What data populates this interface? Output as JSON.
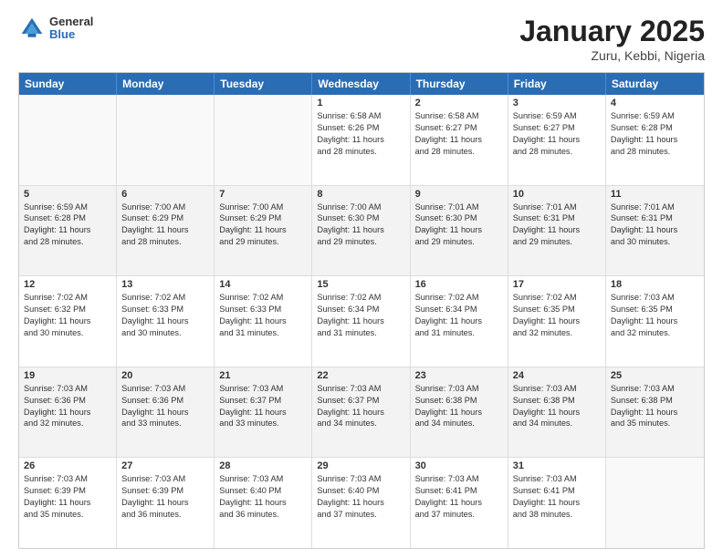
{
  "header": {
    "logo": {
      "general": "General",
      "blue": "Blue"
    },
    "title": "January 2025",
    "location": "Zuru, Kebbi, Nigeria"
  },
  "days_of_week": [
    "Sunday",
    "Monday",
    "Tuesday",
    "Wednesday",
    "Thursday",
    "Friday",
    "Saturday"
  ],
  "weeks": [
    [
      {
        "day": "",
        "info": ""
      },
      {
        "day": "",
        "info": ""
      },
      {
        "day": "",
        "info": ""
      },
      {
        "day": "1",
        "info": "Sunrise: 6:58 AM\nSunset: 6:26 PM\nDaylight: 11 hours\nand 28 minutes."
      },
      {
        "day": "2",
        "info": "Sunrise: 6:58 AM\nSunset: 6:27 PM\nDaylight: 11 hours\nand 28 minutes."
      },
      {
        "day": "3",
        "info": "Sunrise: 6:59 AM\nSunset: 6:27 PM\nDaylight: 11 hours\nand 28 minutes."
      },
      {
        "day": "4",
        "info": "Sunrise: 6:59 AM\nSunset: 6:28 PM\nDaylight: 11 hours\nand 28 minutes."
      }
    ],
    [
      {
        "day": "5",
        "info": "Sunrise: 6:59 AM\nSunset: 6:28 PM\nDaylight: 11 hours\nand 28 minutes."
      },
      {
        "day": "6",
        "info": "Sunrise: 7:00 AM\nSunset: 6:29 PM\nDaylight: 11 hours\nand 28 minutes."
      },
      {
        "day": "7",
        "info": "Sunrise: 7:00 AM\nSunset: 6:29 PM\nDaylight: 11 hours\nand 29 minutes."
      },
      {
        "day": "8",
        "info": "Sunrise: 7:00 AM\nSunset: 6:30 PM\nDaylight: 11 hours\nand 29 minutes."
      },
      {
        "day": "9",
        "info": "Sunrise: 7:01 AM\nSunset: 6:30 PM\nDaylight: 11 hours\nand 29 minutes."
      },
      {
        "day": "10",
        "info": "Sunrise: 7:01 AM\nSunset: 6:31 PM\nDaylight: 11 hours\nand 29 minutes."
      },
      {
        "day": "11",
        "info": "Sunrise: 7:01 AM\nSunset: 6:31 PM\nDaylight: 11 hours\nand 30 minutes."
      }
    ],
    [
      {
        "day": "12",
        "info": "Sunrise: 7:02 AM\nSunset: 6:32 PM\nDaylight: 11 hours\nand 30 minutes."
      },
      {
        "day": "13",
        "info": "Sunrise: 7:02 AM\nSunset: 6:33 PM\nDaylight: 11 hours\nand 30 minutes."
      },
      {
        "day": "14",
        "info": "Sunrise: 7:02 AM\nSunset: 6:33 PM\nDaylight: 11 hours\nand 31 minutes."
      },
      {
        "day": "15",
        "info": "Sunrise: 7:02 AM\nSunset: 6:34 PM\nDaylight: 11 hours\nand 31 minutes."
      },
      {
        "day": "16",
        "info": "Sunrise: 7:02 AM\nSunset: 6:34 PM\nDaylight: 11 hours\nand 31 minutes."
      },
      {
        "day": "17",
        "info": "Sunrise: 7:02 AM\nSunset: 6:35 PM\nDaylight: 11 hours\nand 32 minutes."
      },
      {
        "day": "18",
        "info": "Sunrise: 7:03 AM\nSunset: 6:35 PM\nDaylight: 11 hours\nand 32 minutes."
      }
    ],
    [
      {
        "day": "19",
        "info": "Sunrise: 7:03 AM\nSunset: 6:36 PM\nDaylight: 11 hours\nand 32 minutes."
      },
      {
        "day": "20",
        "info": "Sunrise: 7:03 AM\nSunset: 6:36 PM\nDaylight: 11 hours\nand 33 minutes."
      },
      {
        "day": "21",
        "info": "Sunrise: 7:03 AM\nSunset: 6:37 PM\nDaylight: 11 hours\nand 33 minutes."
      },
      {
        "day": "22",
        "info": "Sunrise: 7:03 AM\nSunset: 6:37 PM\nDaylight: 11 hours\nand 34 minutes."
      },
      {
        "day": "23",
        "info": "Sunrise: 7:03 AM\nSunset: 6:38 PM\nDaylight: 11 hours\nand 34 minutes."
      },
      {
        "day": "24",
        "info": "Sunrise: 7:03 AM\nSunset: 6:38 PM\nDaylight: 11 hours\nand 34 minutes."
      },
      {
        "day": "25",
        "info": "Sunrise: 7:03 AM\nSunset: 6:38 PM\nDaylight: 11 hours\nand 35 minutes."
      }
    ],
    [
      {
        "day": "26",
        "info": "Sunrise: 7:03 AM\nSunset: 6:39 PM\nDaylight: 11 hours\nand 35 minutes."
      },
      {
        "day": "27",
        "info": "Sunrise: 7:03 AM\nSunset: 6:39 PM\nDaylight: 11 hours\nand 36 minutes."
      },
      {
        "day": "28",
        "info": "Sunrise: 7:03 AM\nSunset: 6:40 PM\nDaylight: 11 hours\nand 36 minutes."
      },
      {
        "day": "29",
        "info": "Sunrise: 7:03 AM\nSunset: 6:40 PM\nDaylight: 11 hours\nand 37 minutes."
      },
      {
        "day": "30",
        "info": "Sunrise: 7:03 AM\nSunset: 6:41 PM\nDaylight: 11 hours\nand 37 minutes."
      },
      {
        "day": "31",
        "info": "Sunrise: 7:03 AM\nSunset: 6:41 PM\nDaylight: 11 hours\nand 38 minutes."
      },
      {
        "day": "",
        "info": ""
      }
    ]
  ]
}
